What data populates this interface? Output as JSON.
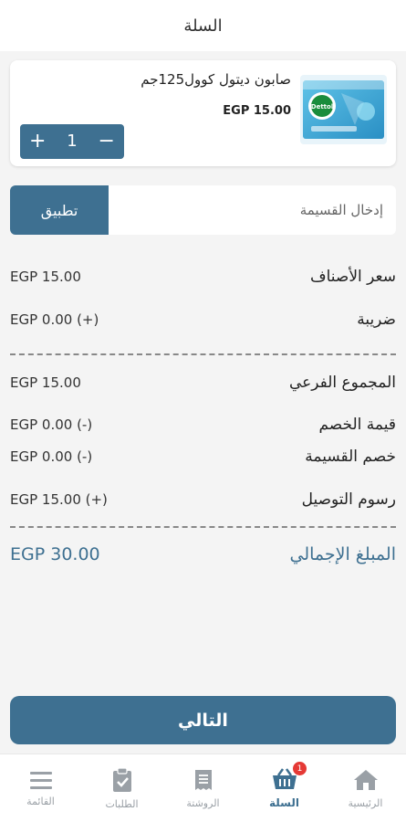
{
  "header": {
    "title": "السلة"
  },
  "cart_item": {
    "name": "صابون ديتول كوول125جم",
    "price": "EGP 15.00",
    "quantity": "1",
    "image_brand": "Dettol"
  },
  "coupon": {
    "placeholder": "إدخال القسيمة",
    "apply_label": "تطبيق"
  },
  "summary": {
    "items_price": {
      "label": "سعر الأصناف",
      "value": "EGP 15.00"
    },
    "tax": {
      "label": "ضريبة",
      "value": "EGP 0.00 (+)"
    },
    "subtotal": {
      "label": "المجموع الفرعي",
      "value": "EGP 15.00"
    },
    "discount": {
      "label": "قيمة الخصم",
      "value": "EGP 0.00 (-)"
    },
    "coupon_discount": {
      "label": "خصم القسيمة",
      "value": "EGP 0.00 (-)"
    },
    "delivery": {
      "label": "رسوم التوصيل",
      "value": "EGP 15.00 (+)"
    },
    "total": {
      "label": "المبلغ الإجمالي",
      "value": "EGP 30.00"
    }
  },
  "next_label": "التالي",
  "tabbar": {
    "home": "الرئيسية",
    "cart": "السلة",
    "cart_badge": "1",
    "prescription": "الروشتة",
    "orders": "الطلبات",
    "menu": "القائمة"
  },
  "colors": {
    "accent": "#3e7091",
    "badge": "#e53935",
    "inactive": "#9aa0a6"
  },
  "icons": [
    "plus-icon",
    "minus-icon",
    "home-icon",
    "basket-icon",
    "receipt-icon",
    "clipboard-check-icon",
    "menu-icon"
  ]
}
